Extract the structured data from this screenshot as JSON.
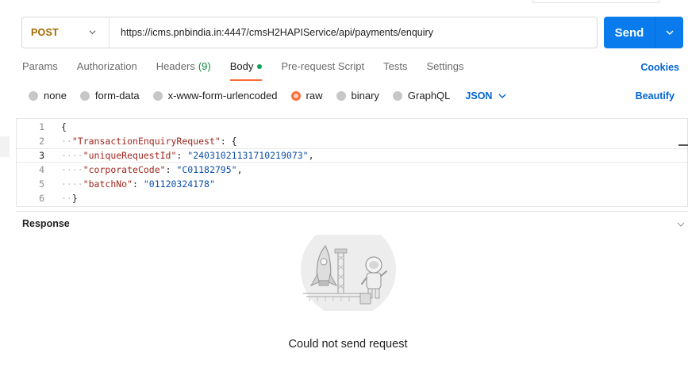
{
  "request": {
    "method": "POST",
    "url": "https://icms.pnbindia.in:4447/cmsH2HAPIService/api/payments/enquiry",
    "send_label": "Send"
  },
  "tabs": [
    {
      "label": "Params"
    },
    {
      "label": "Authorization"
    },
    {
      "label": "Headers",
      "count": "(9)"
    },
    {
      "label": "Body",
      "active": true
    },
    {
      "label": "Pre-request Script"
    },
    {
      "label": "Tests"
    },
    {
      "label": "Settings"
    }
  ],
  "cookies_label": "Cookies",
  "body_options": [
    {
      "label": "none"
    },
    {
      "label": "form-data"
    },
    {
      "label": "x-www-form-urlencoded"
    },
    {
      "label": "raw",
      "selected": true
    },
    {
      "label": "binary"
    },
    {
      "label": "GraphQL"
    }
  ],
  "body_format": "JSON",
  "beautify_label": "Beautify",
  "editor": {
    "line_numbers": [
      "1",
      "2",
      "3",
      "4",
      "5",
      "6"
    ],
    "root_key": "\"TransactionEnquiryRequest\"",
    "fields": [
      {
        "key": "\"uniqueRequestId\"",
        "value": "\"24031021131710219073\""
      },
      {
        "key": "\"corporateCode\"",
        "value": "\"C01182795\""
      },
      {
        "key": "\"batchNo\"",
        "value": "\"01120324178\""
      }
    ]
  },
  "response": {
    "title": "Response",
    "message": "Could not send request"
  },
  "colors": {
    "accent": "#ff6c37",
    "send": "#097bed",
    "link": "#0265d2",
    "method": "#a56900"
  }
}
